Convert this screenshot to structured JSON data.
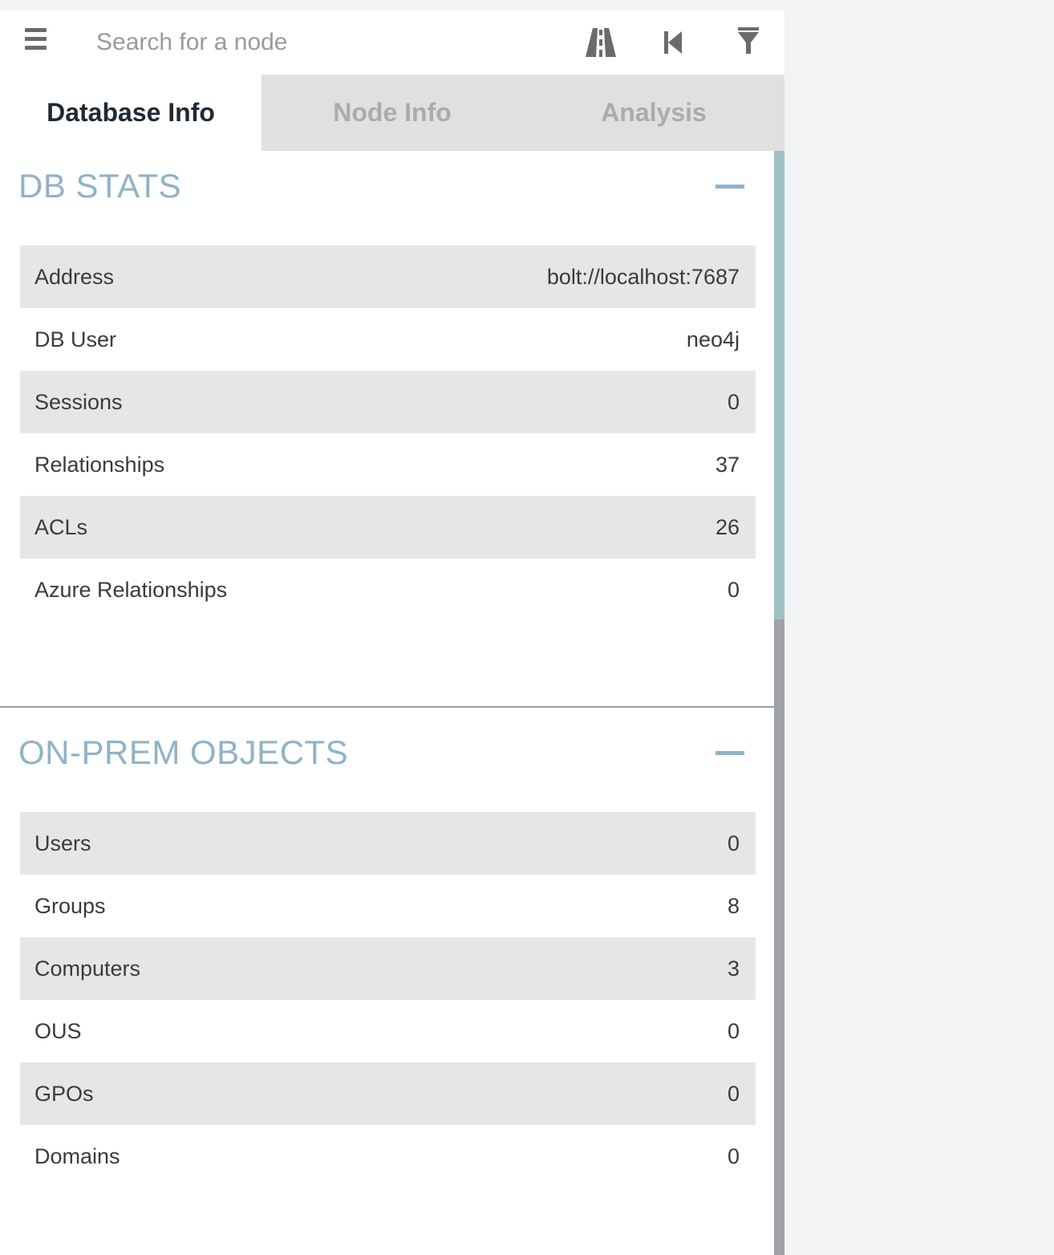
{
  "search": {
    "placeholder": "Search for a node"
  },
  "toolbar": {
    "icons": [
      "menu-icon",
      "road-icon",
      "step-backward-icon",
      "filter-icon"
    ]
  },
  "tabs": [
    {
      "label": "Database Info",
      "active": true
    },
    {
      "label": "Node Info",
      "active": false
    },
    {
      "label": "Analysis",
      "active": false
    }
  ],
  "db_stats": {
    "title": "DB STATS",
    "rows": [
      {
        "label": "Address",
        "value": "bolt://localhost:7687"
      },
      {
        "label": "DB User",
        "value": "neo4j"
      },
      {
        "label": "Sessions",
        "value": "0"
      },
      {
        "label": "Relationships",
        "value": "37"
      },
      {
        "label": "ACLs",
        "value": "26"
      },
      {
        "label": "Azure Relationships",
        "value": "0"
      }
    ]
  },
  "on_prem": {
    "title": "ON-PREM OBJECTS",
    "rows": [
      {
        "label": "Users",
        "value": "0"
      },
      {
        "label": "Groups",
        "value": "8"
      },
      {
        "label": "Computers",
        "value": "3"
      },
      {
        "label": "OUS",
        "value": "0"
      },
      {
        "label": "GPOs",
        "value": "0"
      },
      {
        "label": "Domains",
        "value": "0"
      }
    ]
  },
  "colors": {
    "section_title": "#8fb3c8",
    "tab_inactive_bg": "#e0e0e0",
    "row_striped_bg": "#e6e6e6",
    "scroll_thumb": "#9fc0c3"
  }
}
